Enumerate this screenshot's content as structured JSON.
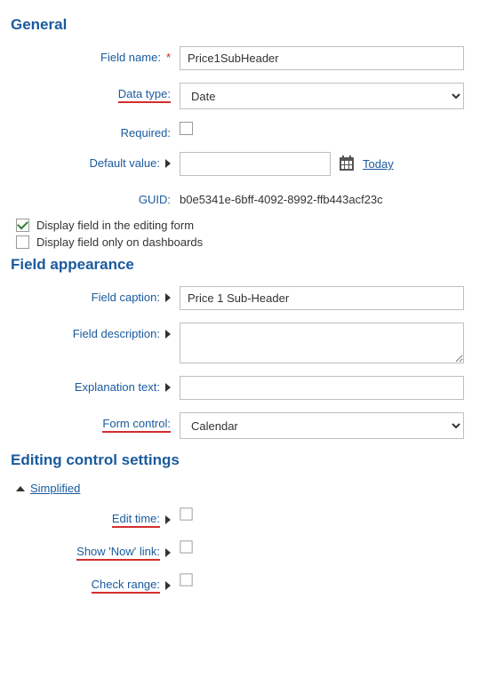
{
  "sections": {
    "general": "General",
    "appearance": "Field appearance",
    "editing": "Editing control settings"
  },
  "general": {
    "field_name_label": "Field name:",
    "field_name_value": "Price1SubHeader",
    "data_type_label": "Data type:",
    "data_type_value": "Date",
    "required_label": "Required:",
    "required_checked": false,
    "default_value_label": "Default value:",
    "default_value_value": "",
    "today_link": "Today",
    "guid_label": "GUID:",
    "guid_value": "b0e5341e-6bff-4092-8992-ffb443acf23c",
    "display_editing_label": "Display field in the editing form",
    "display_editing_checked": true,
    "display_dashboards_label": "Display field only on dashboards",
    "display_dashboards_checked": false
  },
  "appearance": {
    "field_caption_label": "Field caption:",
    "field_caption_value": "Price 1 Sub-Header",
    "field_description_label": "Field description:",
    "field_description_value": "",
    "explanation_label": "Explanation text:",
    "explanation_value": "",
    "form_control_label": "Form control:",
    "form_control_value": "Calendar"
  },
  "editing": {
    "simplified_label": "Simplified",
    "edit_time_label": "Edit time:",
    "edit_time_checked": false,
    "show_now_label": "Show 'Now' link:",
    "show_now_checked": false,
    "check_range_label": "Check range:",
    "check_range_checked": false
  }
}
